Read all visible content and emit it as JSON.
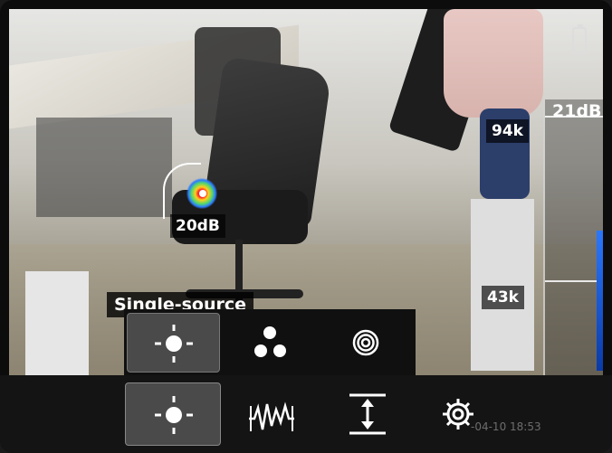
{
  "status": {
    "battery_icon": "battery-icon"
  },
  "scale": {
    "max_level": "21dB",
    "upper_freq": "94k",
    "lower_freq": "43k"
  },
  "source": {
    "level": "20dB"
  },
  "mode": {
    "current_label": "Single-source",
    "options": [
      {
        "icon": "single-source-icon",
        "selected": true
      },
      {
        "icon": "multi-source-icon",
        "selected": false
      },
      {
        "icon": "concentric-rings-icon",
        "selected": false
      }
    ]
  },
  "toolbar": {
    "buttons": [
      {
        "icon": "single-source-icon",
        "selected": true
      },
      {
        "icon": "waveform-icon",
        "selected": false
      },
      {
        "icon": "range-adjust-icon",
        "selected": false
      },
      {
        "icon": "gear-icon",
        "selected": false
      }
    ],
    "datetime": "-04-10 18:53"
  },
  "colors": {
    "scale_fill": "#2a78ff",
    "selected_bg": "#4a4a4a"
  }
}
